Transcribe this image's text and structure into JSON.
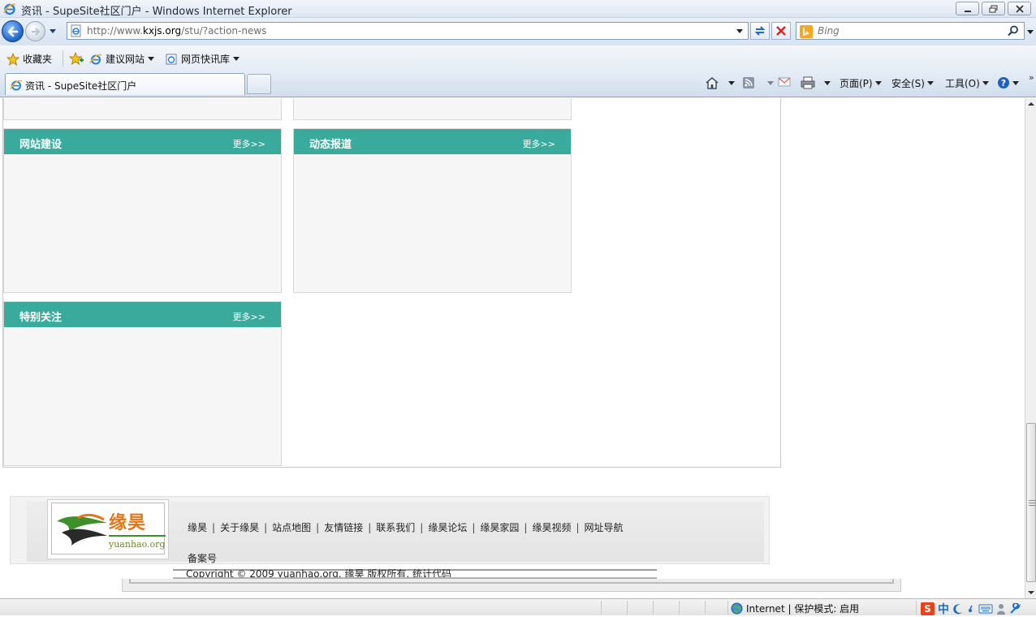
{
  "window": {
    "title": "资讯 - SupeSite社区门户 - Windows Internet Explorer"
  },
  "address_bar": {
    "url_prefix": "http://www.",
    "url_domain": "kxjs.org",
    "url_rest": "/stu/?action-news"
  },
  "search": {
    "placeholder": "Bing"
  },
  "favorites_bar": {
    "favorites_label": "收藏夹",
    "items": [
      {
        "label": "建议网站"
      },
      {
        "label": "网页快讯库"
      }
    ]
  },
  "tabs": {
    "active_label": "资讯 - SupeSite社区门户"
  },
  "command_bar": {
    "page_label": "页面(P)",
    "safety_label": "安全(S)",
    "tools_label": "工具(O)"
  },
  "panels": {
    "website": {
      "title": "网站建设",
      "more": "更多>>"
    },
    "news": {
      "title": "动态报道",
      "more": "更多>>"
    },
    "special": {
      "title": "特别关注",
      "more": "更多>>"
    }
  },
  "footer": {
    "logo_brand": "缘昊",
    "logo_domain": "yuanhao.org",
    "links": [
      "缘昊",
      "关于缘昊",
      "站点地图",
      "友情链接",
      "联系我们",
      "缘昊论坛",
      "缘昊家园",
      "缘昊视频",
      "网址导航"
    ],
    "beian": "备案号",
    "copyright": "Copyright © 2009 yuanhao.org. 缘昊 版权所有. 统计代码"
  },
  "status_bar": {
    "zone": "Internet | 保护模式: 启用",
    "ime_mode": "中"
  },
  "colors": {
    "panel_header": "#3aaa9c",
    "ie_chrome": "#dde6f2"
  }
}
